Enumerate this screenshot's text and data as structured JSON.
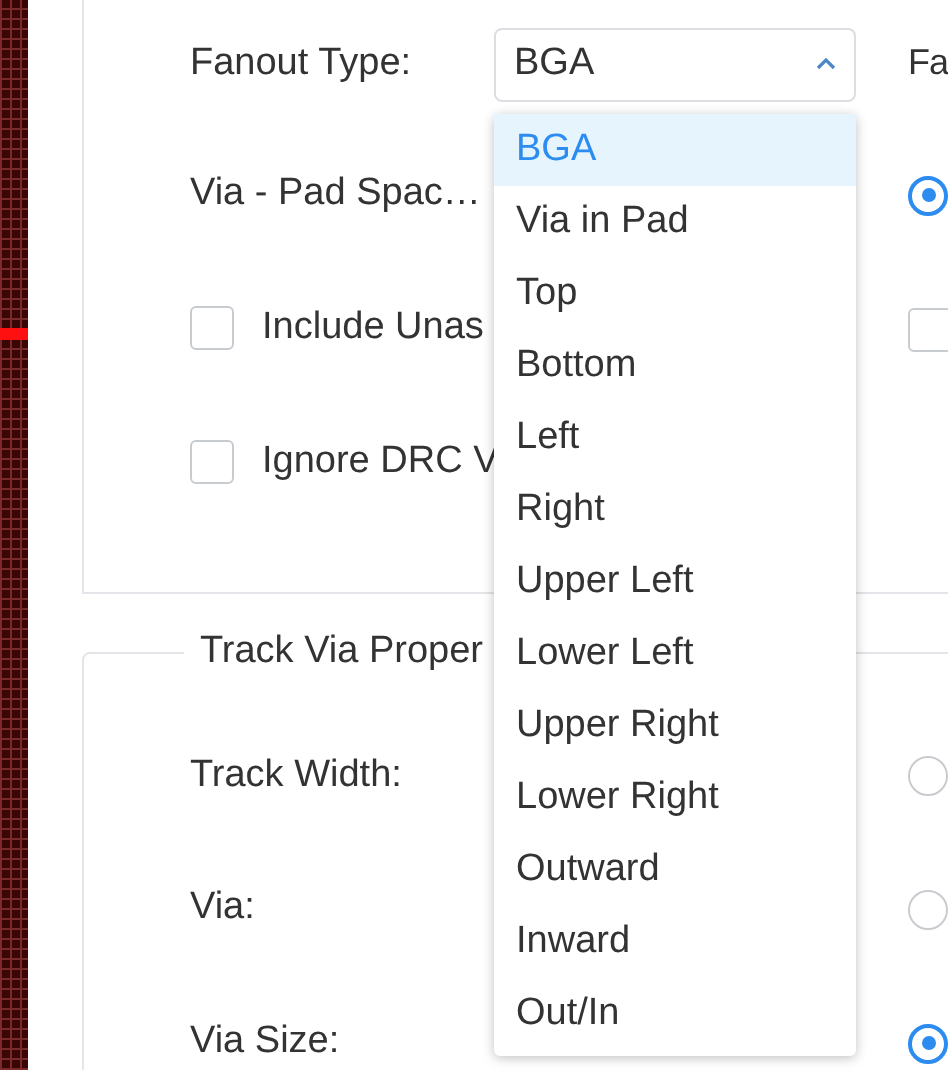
{
  "settings_panel": {
    "rows": [
      {
        "kind": "select",
        "label": "Fanout Type:",
        "value": "BGA",
        "expanded": true,
        "side": {
          "kind": "text",
          "text": "Fa"
        },
        "options": [
          {
            "label": "BGA",
            "selected": true
          },
          {
            "label": "Via in Pad",
            "selected": false
          },
          {
            "label": "Top",
            "selected": false
          },
          {
            "label": "Bottom",
            "selected": false
          },
          {
            "label": "Left",
            "selected": false
          },
          {
            "label": "Right",
            "selected": false
          },
          {
            "label": "Upper Left",
            "selected": false
          },
          {
            "label": "Lower Left",
            "selected": false
          },
          {
            "label": "Upper Right",
            "selected": false
          },
          {
            "label": "Lower Right",
            "selected": false
          },
          {
            "label": "Outward",
            "selected": false
          },
          {
            "label": "Inward",
            "selected": false
          },
          {
            "label": "Out/In",
            "selected": false
          }
        ]
      },
      {
        "kind": "label",
        "label": "Via - Pad Spac…",
        "side": {
          "kind": "radio",
          "selected": true
        }
      },
      {
        "kind": "checkbox",
        "label": "Include Unas",
        "checked": false,
        "side": {
          "kind": "checkbox",
          "checked": false
        }
      },
      {
        "kind": "checkbox",
        "label": "Ignore DRC V",
        "checked": false
      }
    ]
  },
  "track_via_panel": {
    "title": "Track Via Proper",
    "rows": [
      {
        "kind": "label",
        "label": "Track Width:",
        "side": {
          "kind": "radio",
          "selected": false
        }
      },
      {
        "kind": "label",
        "label": "Via:",
        "side": {
          "kind": "radio",
          "selected": false
        }
      },
      {
        "kind": "label",
        "label": "Via Size:",
        "side": {
          "kind": "radio",
          "selected": true
        }
      }
    ]
  }
}
